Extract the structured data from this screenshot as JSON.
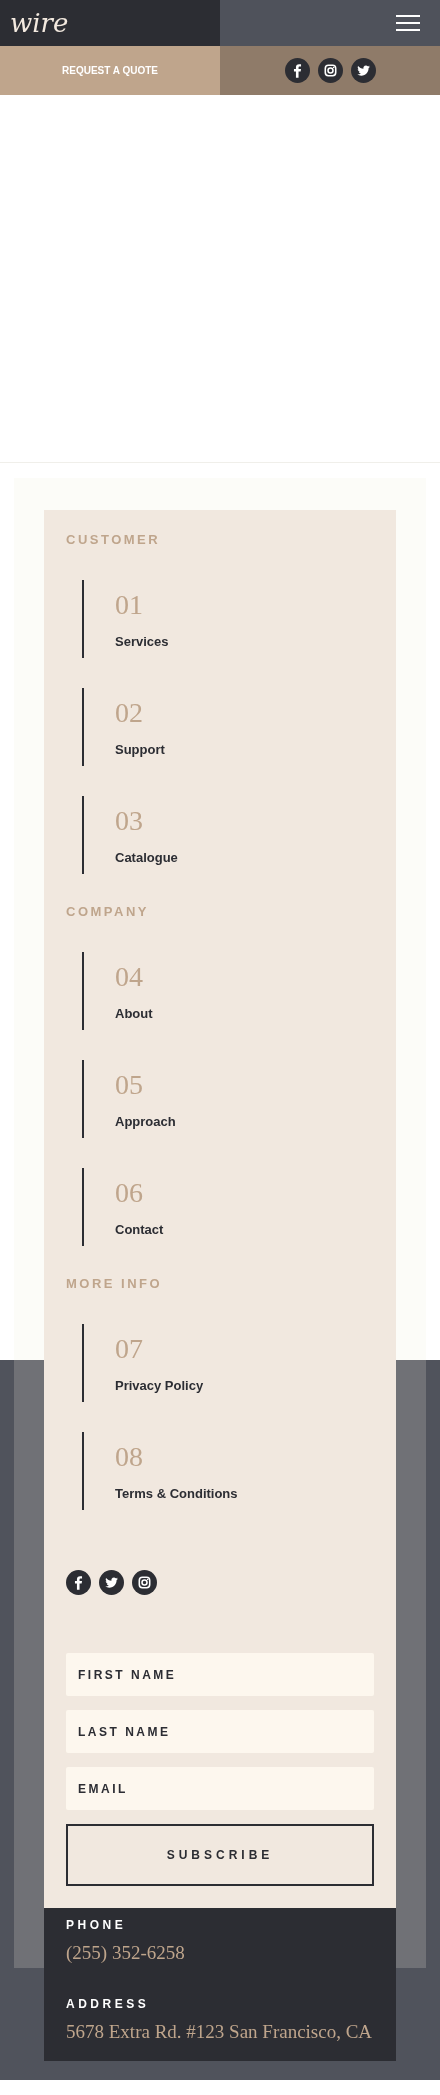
{
  "header": {
    "logo": "wire"
  },
  "top_bar": {
    "cta": "REQUEST A QUOTE",
    "social": [
      {
        "kind": "facebook"
      },
      {
        "kind": "instagram"
      },
      {
        "kind": "twitter"
      }
    ]
  },
  "menu": [
    {
      "heading": "CUSTOMER",
      "items": [
        {
          "number": "01",
          "label": "Services"
        },
        {
          "number": "02",
          "label": "Support"
        },
        {
          "number": "03",
          "label": "Catalogue"
        }
      ]
    },
    {
      "heading": "COMPANY",
      "items": [
        {
          "number": "04",
          "label": "About"
        },
        {
          "number": "05",
          "label": "Approach"
        },
        {
          "number": "06",
          "label": "Contact"
        }
      ]
    },
    {
      "heading": "MORE INFO",
      "items": [
        {
          "number": "07",
          "label": "Privacy Policy"
        },
        {
          "number": "08",
          "label": "Terms & Conditions"
        }
      ]
    }
  ],
  "footer_social": [
    {
      "kind": "facebook"
    },
    {
      "kind": "twitter"
    },
    {
      "kind": "instagram"
    }
  ],
  "form": {
    "fields": [
      {
        "placeholder": "FIRST NAME"
      },
      {
        "placeholder": "LAST NAME"
      },
      {
        "placeholder": "EMAIL"
      }
    ],
    "button": "SUBSCRIBE"
  },
  "contact": [
    {
      "label": "PHONE",
      "value": "(255) 352-6258"
    },
    {
      "label": "ADDRESS",
      "value": "5678 Extra Rd. #123 San Francisco, CA"
    }
  ]
}
